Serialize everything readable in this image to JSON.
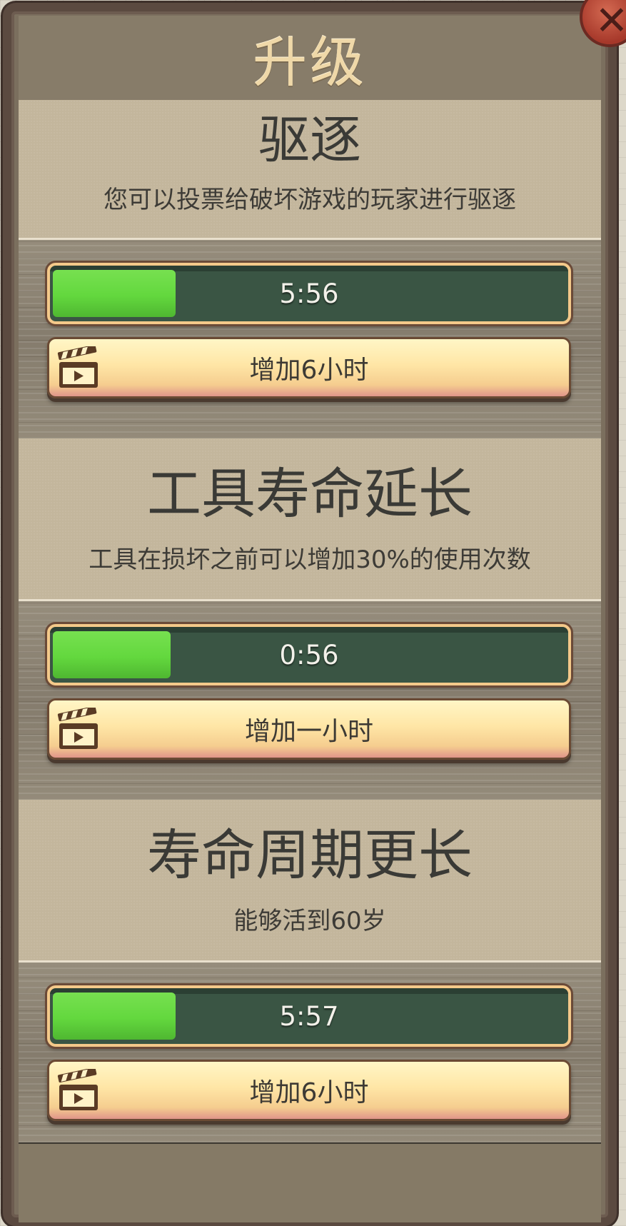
{
  "dialog": {
    "title": "升级",
    "close_icon": "close-x-icon"
  },
  "upgrades": [
    {
      "name": "驱逐",
      "description": "您可以投票给破坏游戏的玩家进行驱逐",
      "timer": "5:56",
      "progress_fraction": 0.24,
      "button_label": "增加6小时",
      "button_icon": "clapperboard-icon"
    },
    {
      "name": "工具寿命延长",
      "description": "工具在损坏之前可以增加30%的使用次数",
      "timer": "0:56",
      "progress_fraction": 0.23,
      "button_label": "增加一小时",
      "button_icon": "clapperboard-icon"
    },
    {
      "name": "寿命周期更长",
      "description": "能够活到60岁",
      "timer": "5:57",
      "progress_fraction": 0.24,
      "button_label": "增加6小时",
      "button_icon": "clapperboard-icon"
    }
  ],
  "colors": {
    "progress_fill": "#63d83e",
    "progress_track": "#3a5544",
    "title": "#efd8a8",
    "button_top": "#fff6c6",
    "button_bottom": "#e0958a",
    "close_button": "#a6382a"
  }
}
